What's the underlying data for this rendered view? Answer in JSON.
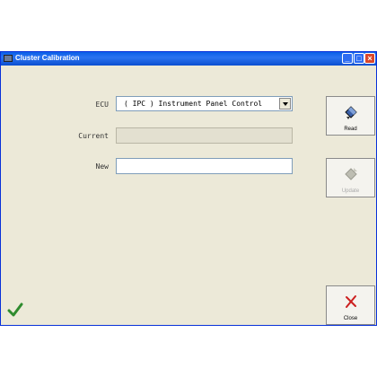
{
  "window": {
    "title": "Cluster Calibration"
  },
  "form": {
    "ecu_label": "ECU",
    "ecu_value": "( IPC ) Instrument Panel Control",
    "current_label": "Current",
    "current_value": "",
    "new_label": "New",
    "new_value": ""
  },
  "buttons": {
    "read_label": "Read",
    "update_label": "Update",
    "close_label": "Close"
  },
  "colors": {
    "titlebar": "#0a5fe8",
    "window_bg": "#ece9d8",
    "check": "#2e8b2e",
    "close_x": "#cc1f1f"
  }
}
